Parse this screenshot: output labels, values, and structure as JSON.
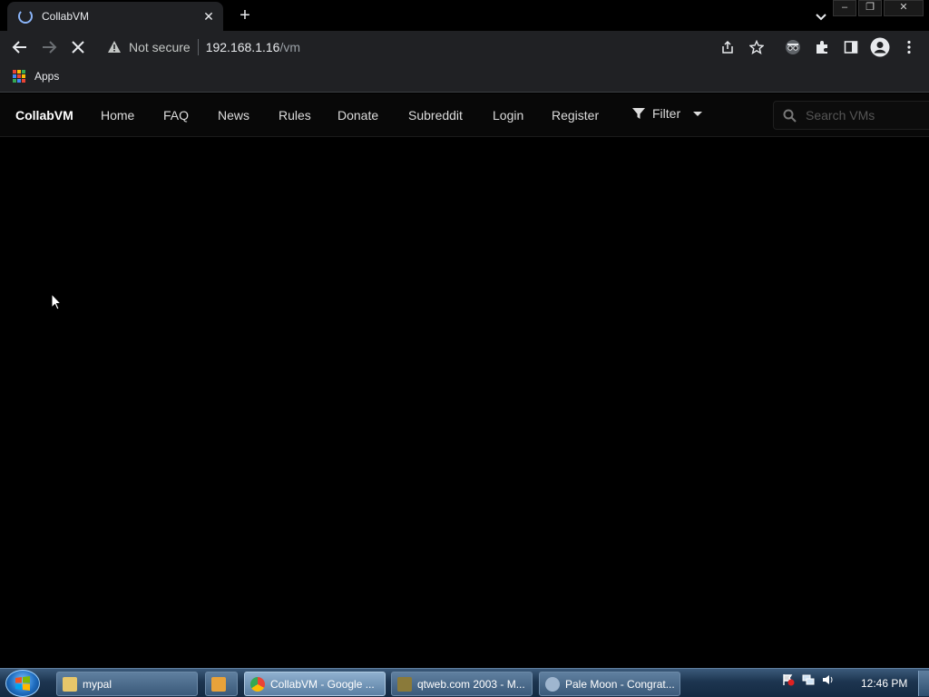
{
  "browser": {
    "tab": {
      "title": "CollabVM"
    },
    "address": {
      "security_label": "Not secure",
      "host": "192.168.1.16",
      "path": "/vm"
    },
    "bookmarks": [
      {
        "label": "Apps"
      }
    ],
    "window_controls": {
      "minimize": "–",
      "restore": "❐",
      "close": "✕"
    }
  },
  "site": {
    "brand": "CollabVM",
    "nav": [
      {
        "label": "Home"
      },
      {
        "label": "FAQ"
      },
      {
        "label": "News"
      },
      {
        "label": "Rules"
      },
      {
        "label": "Donate"
      },
      {
        "label": "Subreddit"
      },
      {
        "label": "Login"
      },
      {
        "label": "Register"
      }
    ],
    "filter_label": "Filter",
    "search_placeholder": "Search VMs"
  },
  "taskbar": {
    "buttons": [
      {
        "label": "mypal",
        "icon": "folder-icon"
      },
      {
        "label": "",
        "icon": "media-player-icon"
      },
      {
        "label": "CollabVM - Google ...",
        "icon": "chrome-icon",
        "active": true
      },
      {
        "label": "qtweb.com 2003 - M...",
        "icon": "qtweb-icon"
      },
      {
        "label": "Pale Moon - Congrat...",
        "icon": "palemoon-icon"
      }
    ],
    "clock": "12:46 PM"
  },
  "colors": {
    "accent": "#8ab4f8",
    "page_bg": "#000000",
    "navbar_bg": "#080808"
  }
}
